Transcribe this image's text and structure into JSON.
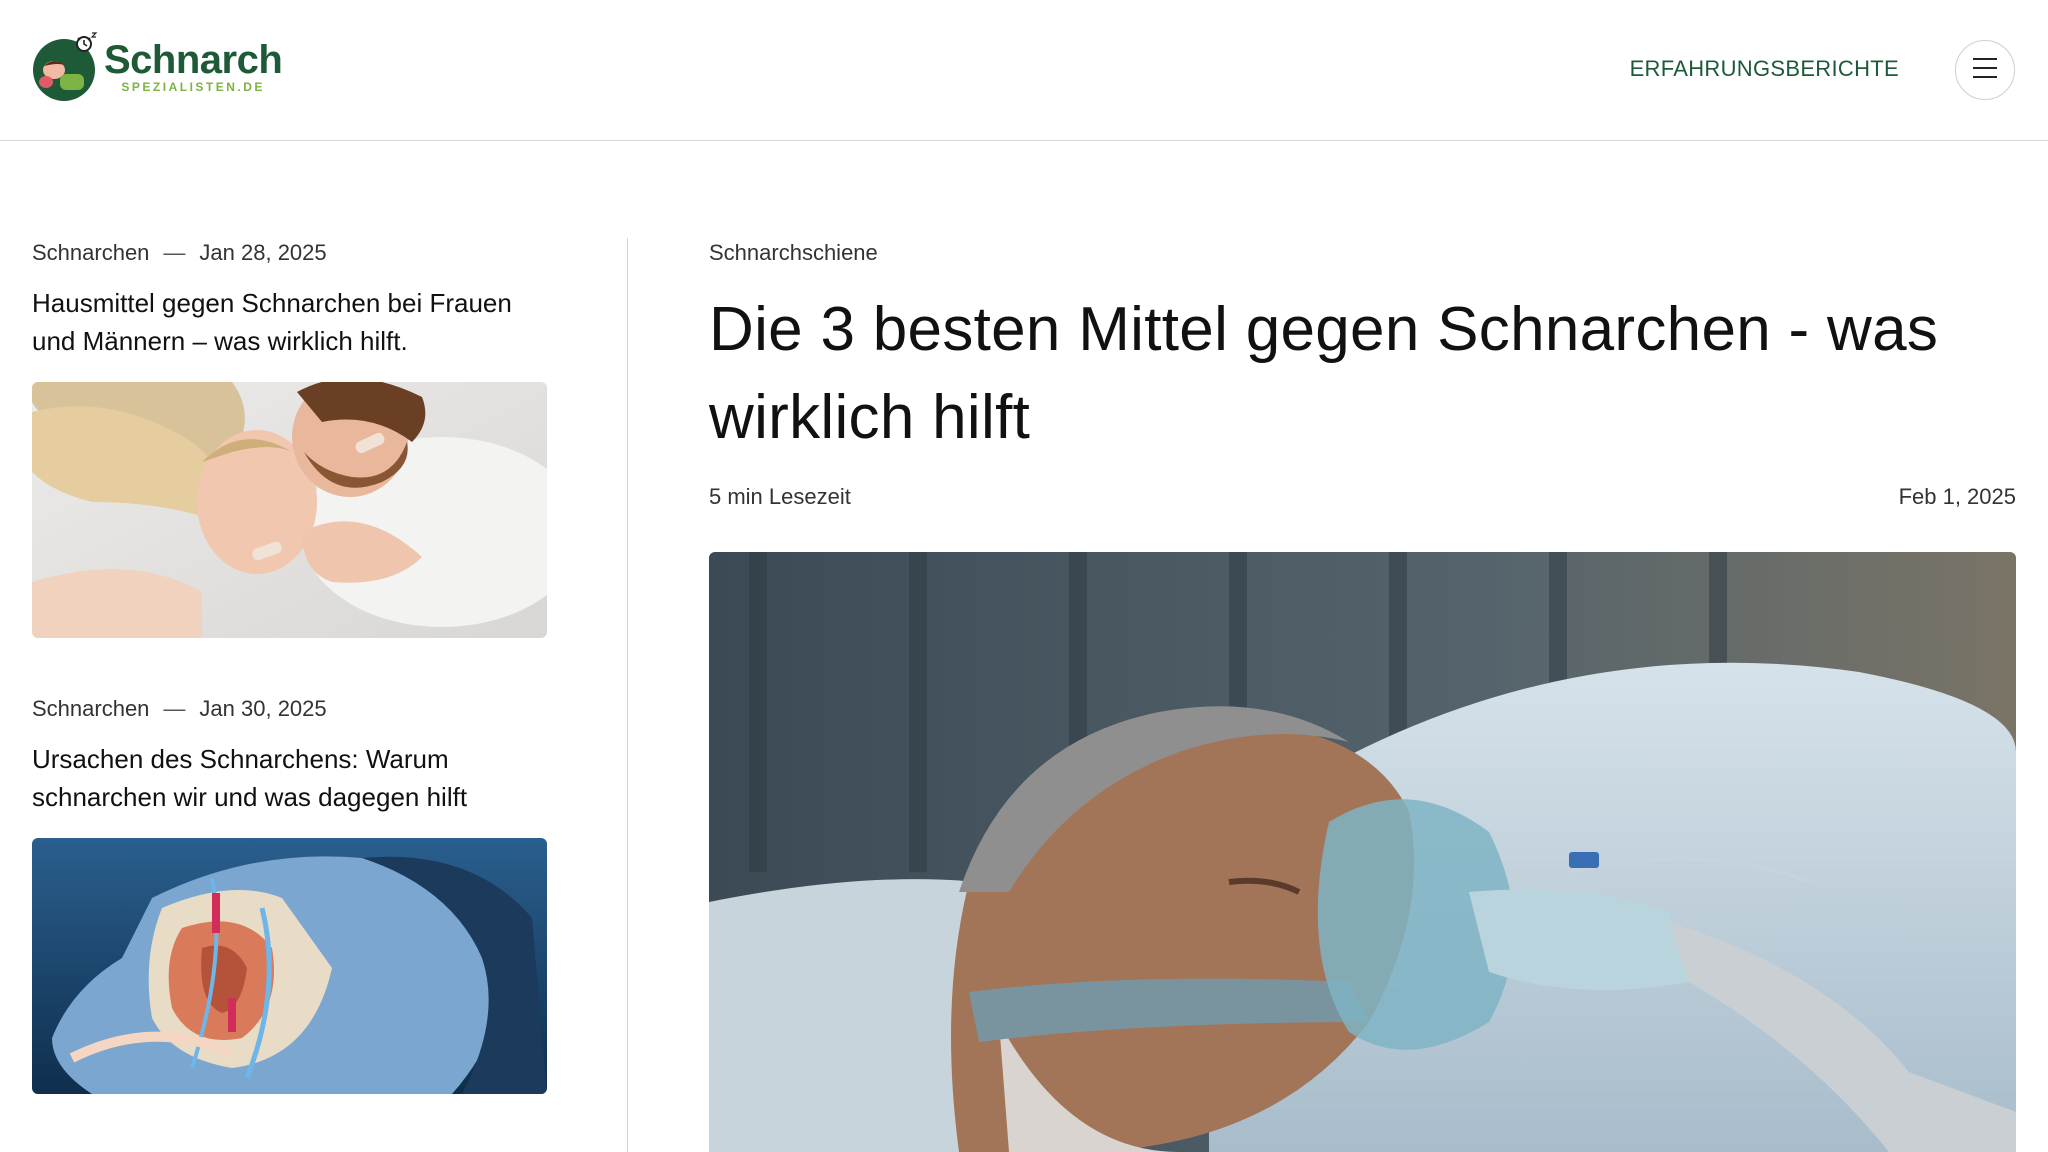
{
  "header": {
    "logo_main": "Schnarch",
    "logo_sub": "SPEZIALISTEN.DE",
    "nav_link": "ERFAHRUNGSBERICHTE"
  },
  "sidebar": {
    "posts": [
      {
        "category": "Schnarchen",
        "separator": "—",
        "date": "Jan 28, 2025",
        "title": "Hausmittel gegen Schnarchen bei Frauen und Männern – was wirklich hilft."
      },
      {
        "category": "Schnarchen",
        "separator": "—",
        "date": "Jan 30, 2025",
        "title": "Ursachen des Schnarchens: Warum schnarchen wir und was dagegen hilft"
      }
    ]
  },
  "main": {
    "category": "Schnarchschiene",
    "title": "Die 3 besten Mittel gegen Schnarchen - was wirklich hilft",
    "read_time": "5 min Lesezeit",
    "date": "Feb 1, 2025"
  },
  "colors": {
    "brand_green": "#1f5a38",
    "brand_lime": "#7cb342"
  }
}
